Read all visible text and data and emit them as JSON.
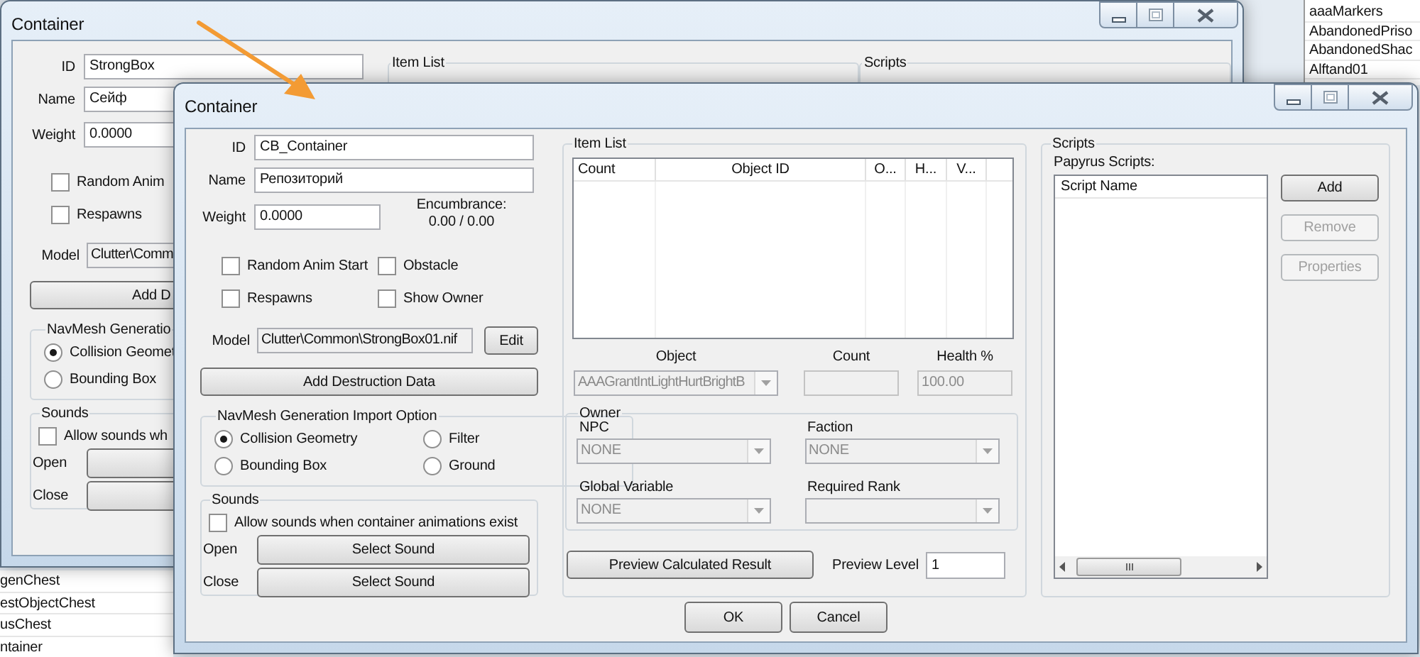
{
  "background_list_top_right": {
    "items": [
      "aaaMarkers",
      "AbandonedPriso",
      "AbandonedShac",
      "Alftand01"
    ]
  },
  "background_list_bottom_left": {
    "items": [
      "genChest",
      "estObjectChest",
      "usChest",
      "ntainer"
    ]
  },
  "back_window": {
    "title": "Container",
    "fields": [
      {
        "label": "ID",
        "value": "StrongBox"
      },
      {
        "label": "Name",
        "value": "Сейф"
      },
      {
        "label": "Weight",
        "value": "0.0000"
      }
    ],
    "checkbox_rows": [
      [
        {
          "label": "Random Anim",
          "checked": false
        }
      ],
      [
        {
          "label": "Respawns",
          "checked": false
        }
      ]
    ],
    "model": {
      "label": "Model",
      "value": "Clutter\\Comm",
      "readonly": true
    },
    "destruction_button": "Add D",
    "navmesh": {
      "title": "NavMesh Generatio",
      "option_rows": [
        [
          {
            "label": "Collision Geomet",
            "selected": true
          }
        ],
        [
          {
            "label": "Bounding Box",
            "selected": false
          }
        ]
      ]
    },
    "sounds": {
      "title": "Sounds",
      "allow": {
        "label": "Allow sounds wh",
        "checked": false
      },
      "rows": [
        {
          "label": "Open"
        },
        {
          "label": "Close"
        }
      ]
    },
    "item_list_title": "Item List",
    "scripts_title": "Scripts"
  },
  "front_window": {
    "title": "Container",
    "fields": [
      {
        "label": "ID",
        "value": "CB_Container"
      },
      {
        "label": "Name",
        "value": "Репозиторий"
      },
      {
        "label": "Weight",
        "value": "0.0000"
      }
    ],
    "encumbrance": {
      "label": "Encumbrance:",
      "value": "0.00 / 0.00"
    },
    "checkbox_rows": [
      [
        {
          "label": "Random Anim Start",
          "checked": false
        },
        {
          "label": "Obstacle",
          "checked": false
        }
      ],
      [
        {
          "label": "Respawns",
          "checked": false
        },
        {
          "label": "Show Owner",
          "checked": false
        }
      ]
    ],
    "model": {
      "label": "Model",
      "value": "Clutter\\Common\\StrongBox01.nif",
      "readonly": true,
      "button": "Edit"
    },
    "destruction_button": "Add Destruction Data",
    "navmesh": {
      "title": "NavMesh Generation Import Option",
      "option_rows": [
        [
          {
            "label": "Collision Geometry",
            "selected": true
          },
          {
            "label": "Filter",
            "selected": false
          }
        ],
        [
          {
            "label": "Bounding Box",
            "selected": false
          },
          {
            "label": "Ground",
            "selected": false
          }
        ]
      ]
    },
    "sounds": {
      "title": "Sounds",
      "allow": {
        "label": "Allow sounds when container animations exist",
        "checked": false
      },
      "rows": [
        {
          "label": "Open",
          "button": "Select Sound"
        },
        {
          "label": "Close",
          "button": "Select Sound"
        }
      ]
    },
    "item_list": {
      "title": "Item List",
      "columns": [
        "Count",
        "Object ID",
        "O...",
        "H...",
        "V..."
      ],
      "object": {
        "label": "Object",
        "value": "AAAGrantIntLightHurtBrightB",
        "disabled": true
      },
      "count": {
        "label": "Count",
        "disabled": true
      },
      "health": {
        "label": "Health %",
        "value": "100.00",
        "disabled": true
      },
      "owner": {
        "title": "Owner",
        "fields": [
          {
            "label": "NPC",
            "value": "NONE",
            "disabled": true
          },
          {
            "label": "Faction",
            "value": "NONE",
            "disabled": true
          },
          {
            "label": "Global Variable",
            "value": "NONE",
            "disabled": true
          },
          {
            "label": "Required Rank",
            "disabled": true
          }
        ]
      },
      "preview_button": "Preview Calculated Result",
      "preview_level": {
        "label": "Preview Level",
        "value": "1"
      }
    },
    "scripts": {
      "title": "Scripts",
      "subtitle": "Papyrus Scripts:",
      "columns": [
        "Script Name"
      ],
      "buttons": [
        {
          "label": "Add",
          "disabled": false
        },
        {
          "label": "Remove",
          "disabled": true
        },
        {
          "label": "Properties",
          "disabled": true
        }
      ]
    },
    "buttons": [
      "OK",
      "Cancel"
    ]
  }
}
